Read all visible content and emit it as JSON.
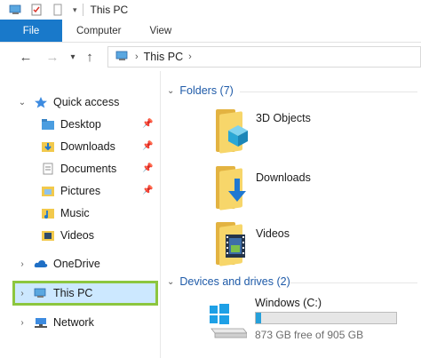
{
  "window": {
    "title": "This PC"
  },
  "ribbon": {
    "tabs": [
      "File",
      "Computer",
      "View"
    ]
  },
  "address": {
    "path": "This PC"
  },
  "nav": {
    "quick_access": "Quick access",
    "items": [
      {
        "label": "Desktop",
        "pinned": true
      },
      {
        "label": "Downloads",
        "pinned": true
      },
      {
        "label": "Documents",
        "pinned": true
      },
      {
        "label": "Pictures",
        "pinned": true
      },
      {
        "label": "Music",
        "pinned": false
      },
      {
        "label": "Videos",
        "pinned": false
      }
    ],
    "onedrive": "OneDrive",
    "this_pc": "This PC",
    "network": "Network"
  },
  "content": {
    "folders_header": "Folders (7)",
    "folders": [
      "3D Objects",
      "Downloads",
      "Videos"
    ],
    "devices_header": "Devices and drives (2)",
    "drive": {
      "name": "Windows (C:)",
      "free_text": "873 GB free of 905 GB",
      "used_fraction": 0.035
    }
  },
  "colors": {
    "accent": "#1979ca",
    "selection": "#cce8ff",
    "highlight_border": "#8cc63f",
    "drive_bar": "#26a0da"
  }
}
